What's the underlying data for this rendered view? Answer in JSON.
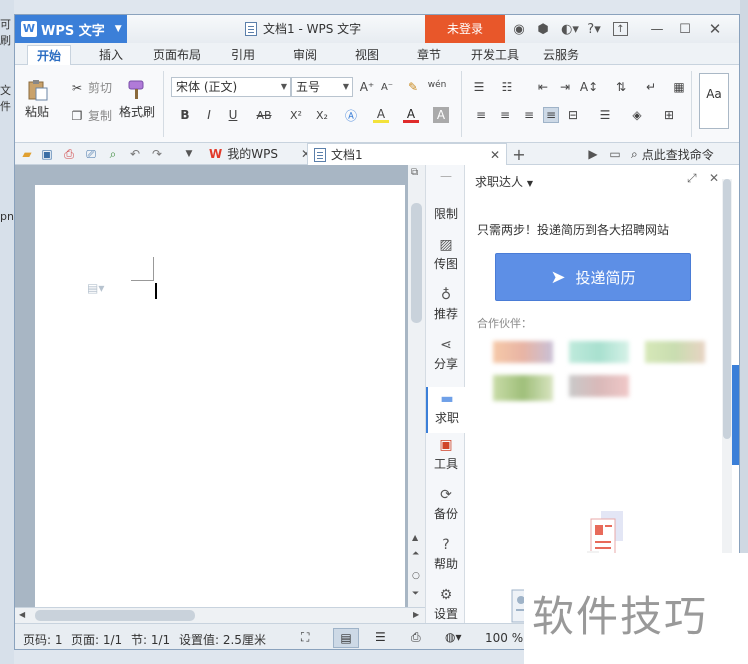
{
  "desktop": {
    "left_snippets": [
      "可刷",
      "文件",
      "png"
    ]
  },
  "titlebar": {
    "app_name": "WPS 文字",
    "doc_title": "文档1 - WPS 文字",
    "login": "未登录",
    "help": "?"
  },
  "ribbon_tabs": [
    "开始",
    "插入",
    "页面布局",
    "引用",
    "审阅",
    "视图",
    "章节",
    "开发工具",
    "云服务"
  ],
  "ribbon": {
    "paste": "粘贴",
    "cut": "剪切",
    "copy": "复制",
    "format_painter": "格式刷",
    "font_name": "宋体 (正文)",
    "font_size": "五号",
    "bold": "B",
    "italic": "I",
    "underline": "U",
    "strikethrough": "AB",
    "superscript": "X²",
    "subscript": "X₂",
    "font_color": "A",
    "highlight": "A",
    "style_preview": "Aa"
  },
  "doc_tabs": [
    {
      "label": "我的WPS"
    },
    {
      "label": "文档1"
    }
  ],
  "search_command": "点此查找命令",
  "side_nav": [
    "限制",
    "传图",
    "推荐",
    "分享",
    "求职",
    "工具",
    "备份",
    "帮助",
    "设置"
  ],
  "panel": {
    "title": "求职达人",
    "intro": "只需两步！投递简历到各大招聘网站",
    "submit": "投递简历",
    "partners": "合作伙伴："
  },
  "status": {
    "page_no": "页码: 1",
    "pages": "页面: 1/1",
    "section": "节: 1/1",
    "setting": "设置值: 2.5厘米",
    "zoom": "100 %"
  },
  "watermark": "软件技巧"
}
